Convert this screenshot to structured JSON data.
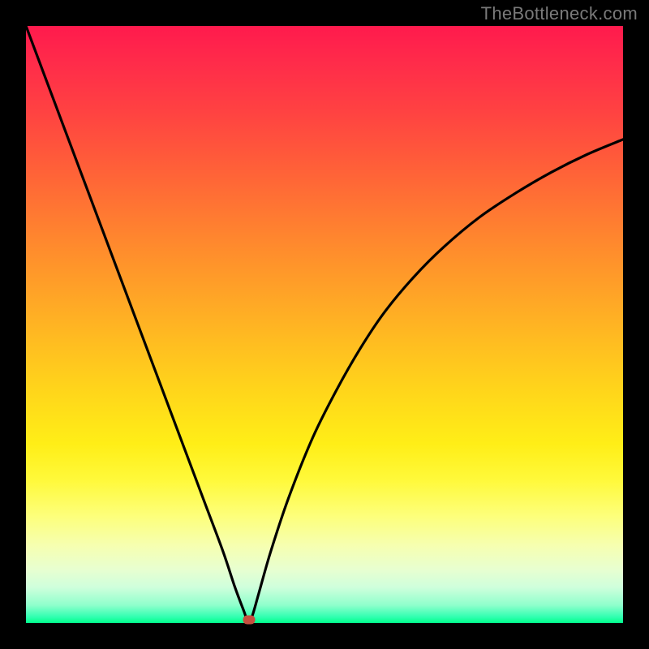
{
  "watermark": "TheBottleneck.com",
  "chart_data": {
    "type": "line",
    "title": "",
    "xlabel": "",
    "ylabel": "",
    "xlim": [
      0,
      100
    ],
    "ylim": [
      0,
      100
    ],
    "grid": false,
    "series": [
      {
        "name": "curve",
        "x": [
          0,
          3,
          6,
          9,
          12,
          15,
          18,
          21,
          24,
          27,
          30,
          33,
          35,
          36.5,
          37.3,
          38,
          39,
          41,
          44,
          48,
          52,
          56,
          60,
          65,
          70,
          76,
          82,
          88,
          94,
          100
        ],
        "y": [
          100,
          92,
          84,
          76,
          68,
          60,
          52,
          44,
          36,
          28,
          20,
          12,
          6,
          2,
          0,
          1.5,
          5,
          12,
          21,
          31,
          39,
          46,
          52,
          58,
          63,
          68,
          72,
          75.5,
          78.5,
          81
        ]
      }
    ],
    "marker": {
      "x": 37.3,
      "y": 0.5
    },
    "background_gradient": {
      "top_color": "#ff1a4d",
      "bottom_color": "#00ff8a"
    }
  }
}
